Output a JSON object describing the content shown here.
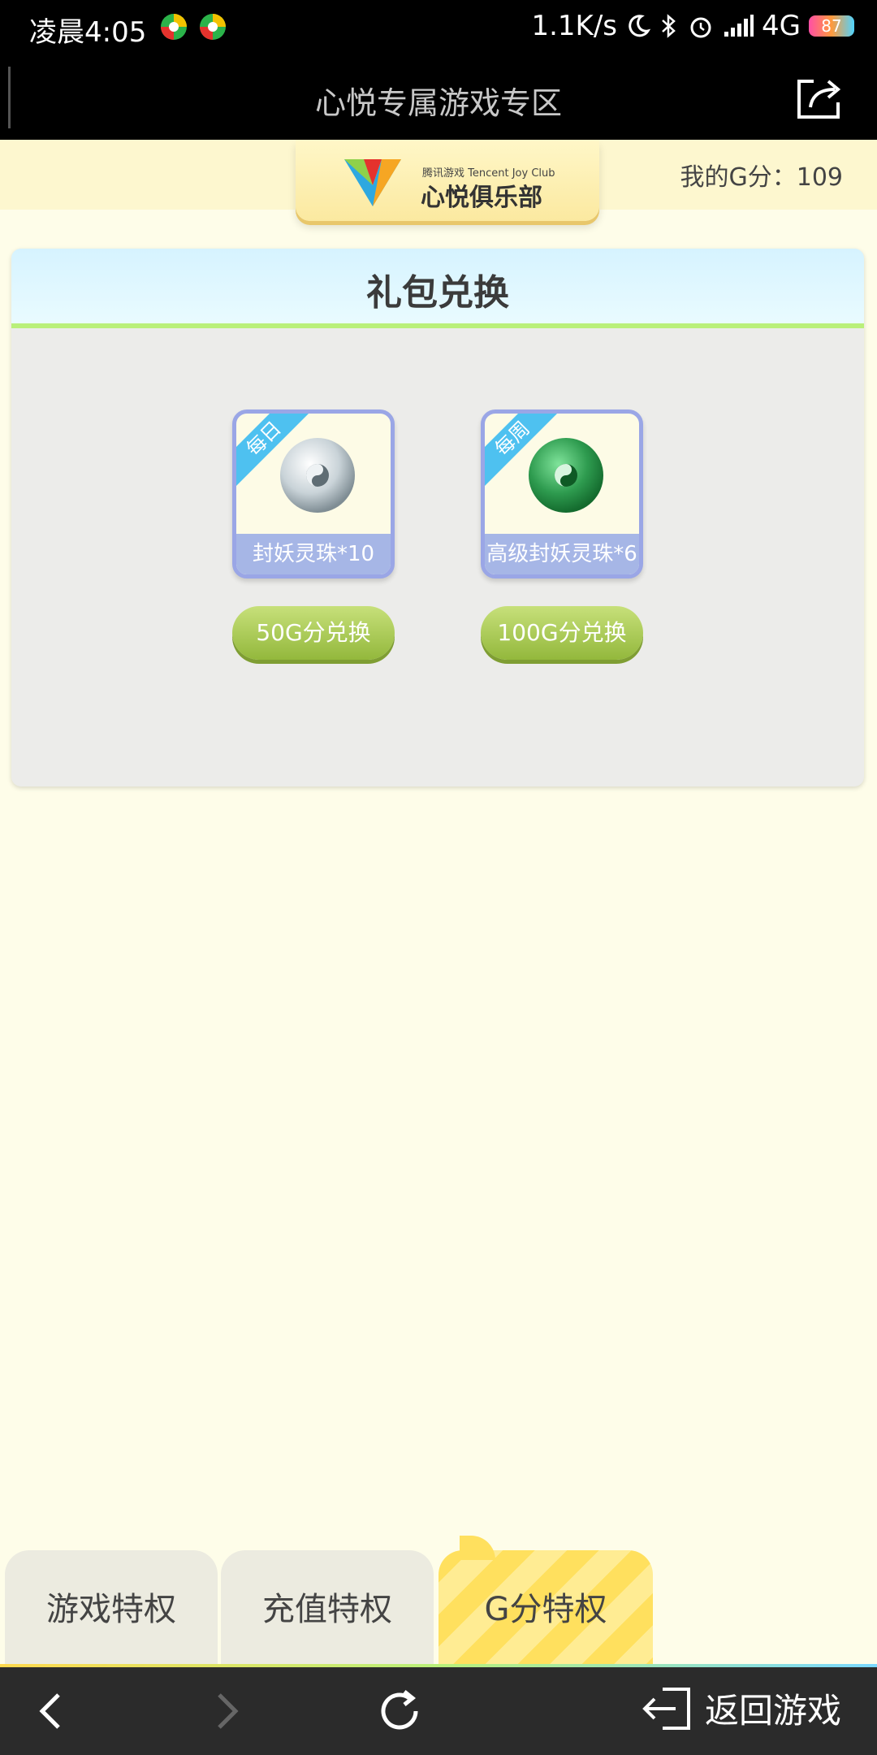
{
  "status_bar": {
    "time": "凌晨4:05",
    "network_speed": "1.1K/s",
    "network_type": "4G",
    "battery": "87",
    "icons": [
      "app-icon",
      "app-icon",
      "moon-icon",
      "bluetooth-icon",
      "alarm-icon",
      "signal-icon",
      "battery-icon"
    ]
  },
  "title_bar": {
    "title": "心悦专属游戏专区",
    "share_icon": "share-icon"
  },
  "header": {
    "logo_sub": "腾讯游戏 Tencent Joy Club",
    "logo_main": "心悦俱乐部",
    "g_score_text": "我的G分：109"
  },
  "card": {
    "title": "礼包兑换",
    "gifts": [
      {
        "tag": "每日",
        "label": "封妖灵珠*10",
        "orb_color": "#c9d3d8",
        "button": "50G分兑换"
      },
      {
        "tag": "每周",
        "label": "高级封妖灵珠*6",
        "orb_color": "#2e9b4f",
        "button": "100G分兑换"
      }
    ]
  },
  "tabs": [
    {
      "label": "游戏特权",
      "active": false
    },
    {
      "label": "充值特权",
      "active": false
    },
    {
      "label": "G分特权",
      "active": true
    }
  ],
  "browser_nav": {
    "back_icon": "chevron-left-icon",
    "forward_icon": "chevron-right-icon",
    "refresh_icon": "refresh-icon",
    "return_label": "返回游戏"
  },
  "colors": {
    "accent_green": "#93b83c",
    "tab_active": "#ffe05e",
    "card_header": "#d6f3ff"
  }
}
